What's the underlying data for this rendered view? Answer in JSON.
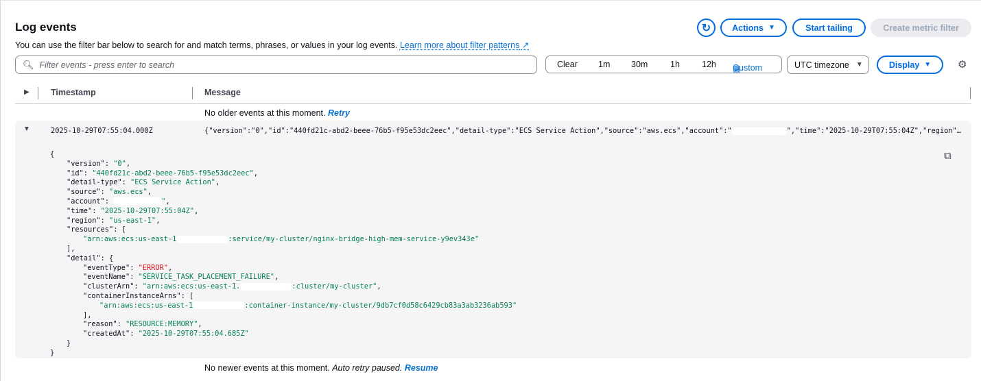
{
  "header": {
    "title": "Log events",
    "description": "You can use the filter bar below to search for and match terms, phrases, or values in your log events.",
    "learn_more": "Learn more about filter patterns"
  },
  "toolbar": {
    "actions": "Actions",
    "start_tailing": "Start tailing",
    "create_metric_filter": "Create metric filter"
  },
  "search": {
    "placeholder": "Filter events - press enter to search",
    "value": ""
  },
  "time_range": {
    "clear": "Clear",
    "options": [
      "1m",
      "30m",
      "1h",
      "12h"
    ],
    "custom": "Custom"
  },
  "timezone": "UTC timezone",
  "display": "Display",
  "table": {
    "col_timestamp": "Timestamp",
    "col_message": "Message"
  },
  "older": {
    "text": "No older events at this moment.",
    "link": "Retry"
  },
  "event": {
    "timestamp": "2025-10-29T07:55:04.000Z",
    "summary_pre": "{\"version\":\"0\",\"id\":\"440fd21c-abd2-beee-76b5-f95e53dc2eec\",\"detail-type\":\"ECS Service Action\",\"source\":\"aws.ecs\",\"account\":\"",
    "summary_post": "\",\"time\":\"2025-10-29T07:55:04Z\",\"region\"…",
    "lines": [
      {
        "indent": 0,
        "text": "{"
      },
      {
        "indent": 1,
        "key": "\"version\": ",
        "value": "\"0\"",
        "tail": ","
      },
      {
        "indent": 1,
        "key": "\"id\": ",
        "value": "\"440fd21c-abd2-beee-76b5-f95e53dc2eec\"",
        "tail": ","
      },
      {
        "indent": 1,
        "key": "\"detail-type\": ",
        "value": "\"ECS Service Action\"",
        "tail": ","
      },
      {
        "indent": 1,
        "key": "\"source\": ",
        "value": "\"aws.ecs\"",
        "tail": ","
      },
      {
        "indent": 1,
        "key": "\"account\": ",
        "redacted": true,
        "value": "\"",
        "tail": ","
      },
      {
        "indent": 1,
        "key": "\"time\": ",
        "value": "\"2025-10-29T07:55:04Z\"",
        "tail": ","
      },
      {
        "indent": 1,
        "key": "\"region\": ",
        "value": "\"us-east-1\"",
        "tail": ","
      },
      {
        "indent": 1,
        "key": "\"resources\": ",
        "tail": "["
      },
      {
        "indent": 2,
        "value": "\"arn:aws:ecs:us-east-1",
        "redacted": true,
        "value2": ":service/my-cluster/nginx-bridge-high-mem-service-y9ev343e\""
      },
      {
        "indent": 1,
        "text": "],"
      },
      {
        "indent": 1,
        "key": "\"detail\": ",
        "tail": "{"
      },
      {
        "indent": 2,
        "key": "\"eventType\": ",
        "value": "\"ERROR\"",
        "tail": ",",
        "error": true
      },
      {
        "indent": 2,
        "key": "\"eventName\": ",
        "value": "\"SERVICE_TASK_PLACEMENT_FAILURE\"",
        "tail": ","
      },
      {
        "indent": 2,
        "key": "\"clusterArn\": ",
        "value": "\"arn:aws:ecs:us-east-1.",
        "redacted": true,
        "value2": ":cluster/my-cluster\"",
        "tail": ","
      },
      {
        "indent": 2,
        "key": "\"containerInstanceArns\": ",
        "tail": "["
      },
      {
        "indent": 3,
        "value": "\"arn:aws:ecs:us-east-1",
        "redacted": true,
        "value2": ":container-instance/my-cluster/9db7cf0d58c6429cb83a3ab3236ab593\""
      },
      {
        "indent": 2,
        "text": "],"
      },
      {
        "indent": 2,
        "key": "\"reason\": ",
        "value": "\"RESOURCE:MEMORY\"",
        "tail": ","
      },
      {
        "indent": 2,
        "key": "\"createdAt\": ",
        "value": "\"2025-10-29T07:55:04.685Z\""
      },
      {
        "indent": 1,
        "text": "}"
      },
      {
        "indent": 0,
        "text": "}"
      }
    ]
  },
  "newer": {
    "text": "No newer events at this moment.",
    "italic": "Auto retry paused.",
    "link": "Resume"
  },
  "colors": {
    "accent": "#006ce0",
    "string": "#037f51",
    "error": "#d91515"
  }
}
